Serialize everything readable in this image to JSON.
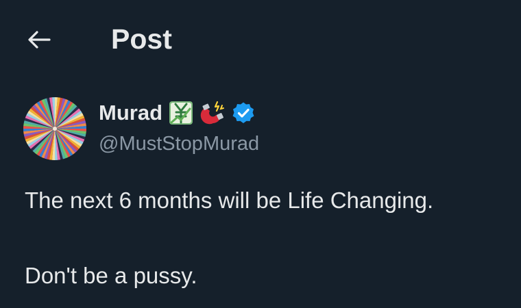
{
  "header": {
    "back_icon": "arrow-left-icon",
    "title": "Post"
  },
  "author": {
    "name": "Murad",
    "handle": "@MustStopMurad",
    "badges": [
      "yen-chart-emoji-icon",
      "magnet-emoji-icon",
      "verified-badge-icon"
    ],
    "verified_color": "#1d9bf0"
  },
  "tweet": {
    "lines": [
      "The next 6 months will be Life Changing.",
      "Don't be a pussy."
    ]
  },
  "colors": {
    "background": "#15202b",
    "text": "#e7e9ea",
    "secondary_text": "#8b98a5"
  }
}
